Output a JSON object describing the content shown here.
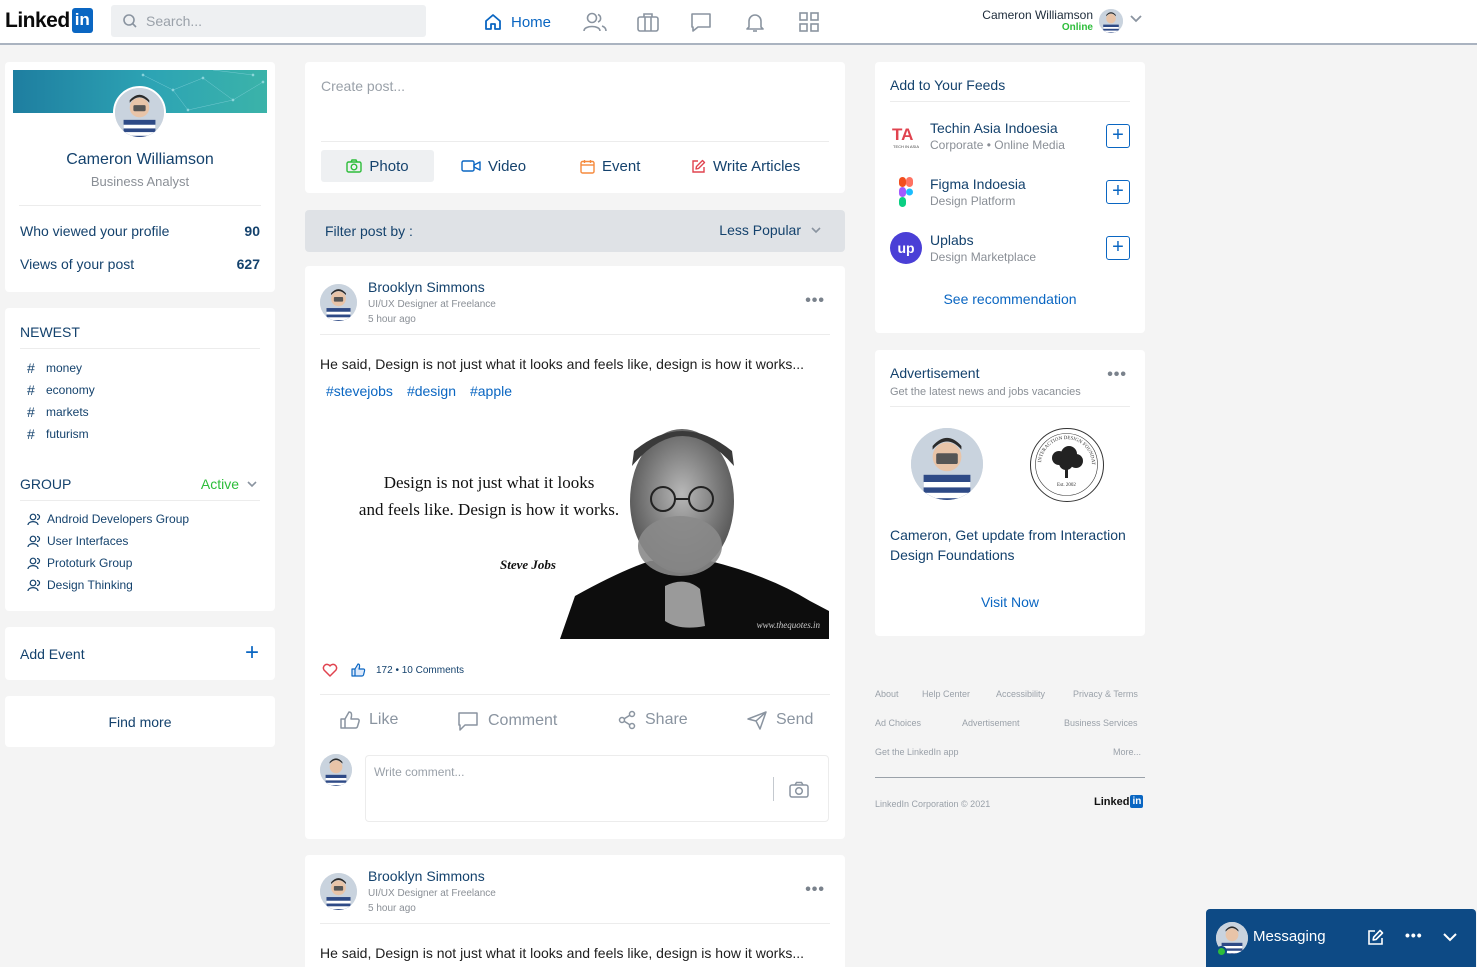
{
  "nav": {
    "logo_text": "Linked",
    "logo_box": "in",
    "search_placeholder": "Search...",
    "home_label": "Home",
    "user_name": "Cameron Williamson",
    "user_status": "Online"
  },
  "profile": {
    "name": "Cameron Williamson",
    "title": "Business Analyst",
    "stats": [
      {
        "label": "Who viewed your profile",
        "value": "90"
      },
      {
        "label": "Views of your post",
        "value": "627"
      }
    ]
  },
  "newest": {
    "title": "NEWEST",
    "tags": [
      "money",
      "economy",
      "markets",
      "futurism"
    ]
  },
  "group": {
    "title": "GROUP",
    "filter": "Active",
    "items": [
      "Android Developers Group",
      "User Interfaces",
      "Prototurk Group",
      "Design Thinking"
    ]
  },
  "add_event": {
    "label": "Add Event",
    "plus": "+"
  },
  "find_more": "Find more",
  "create_post": {
    "placeholder": "Create post...",
    "buttons": [
      "Photo",
      "Video",
      "Event",
      "Write Articles"
    ]
  },
  "filter": {
    "label": "Filter post by :",
    "value": "Less Popular"
  },
  "posts": [
    {
      "author": "Brooklyn Simmons",
      "role": "UI/UX Designer at Freelance",
      "time": "5 hour ago",
      "text": "He said, Design is not just what it looks and feels like, design is how it works...",
      "hashtags": [
        "#stevejobs",
        "#design",
        "#apple"
      ],
      "image": {
        "quote_line1": "Design is not just what it looks",
        "quote_line2": "and feels like. Design is how it works.",
        "author": "Steve Jobs",
        "source": "www.thequotes.in"
      },
      "reactions": "172 • 10 Comments",
      "actions": [
        "Like",
        "Comment",
        "Share",
        "Send"
      ],
      "comment_placeholder": "Write comment..."
    },
    {
      "author": "Brooklyn Simmons",
      "role": "UI/UX Designer at Freelance",
      "time": "5 hour ago",
      "text": "He said, Design is not just what it looks and feels like, design is how it works..."
    }
  ],
  "feeds": {
    "title": "Add to Your Feeds",
    "items": [
      {
        "name": "Techin Asia Indoesia",
        "sub": "Corporate • Online Media",
        "logo": "TA",
        "logo_caption": "TECH IN ASIA"
      },
      {
        "name": "Figma Indoesia",
        "sub": "Design Platform",
        "logo": "figma"
      },
      {
        "name": "Uplabs",
        "sub": "Design Marketplace",
        "logo": "up"
      }
    ],
    "see_more": "See recommendation"
  },
  "ad": {
    "title": "Advertisement",
    "subtitle": "Get the latest news and jobs vacancies",
    "text_prefix": "Cameron, Get update from ",
    "text_bold": "Interaction Design Foundations",
    "badge_arc": "INTERACTION DESIGN FOUNDATION",
    "badge_est": "Est. 2002",
    "cta": "Visit Now"
  },
  "footer": {
    "links": [
      "About",
      "Help Center",
      "Accessibility",
      "Privacy & Terms",
      "Ad Choices",
      "Advertisement",
      "Business Services",
      "Get the LinkedIn app",
      "More..."
    ],
    "copyright": "LinkedIn Corporation © 2021",
    "logo_text": "Linked",
    "logo_box": "in"
  },
  "messaging": {
    "label": "Messaging"
  },
  "colors": {
    "brand": "#0a66c2",
    "navy": "#14426d",
    "online": "#2dbd3a",
    "messaging_bg": "#0d4a85"
  }
}
